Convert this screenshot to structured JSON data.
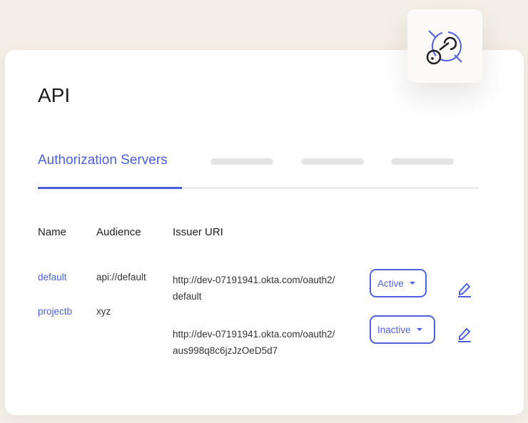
{
  "title": "API",
  "tabs": {
    "active": "Authorization Servers"
  },
  "columns": [
    "Name",
    "Audience",
    "Issuer URI"
  ],
  "rows": [
    {
      "name": "default",
      "audience": "api://default",
      "uri1": "http://dev-07191941.okta.com/oauth2/",
      "uri2": "default",
      "status": "Active"
    },
    {
      "name": "projectb",
      "audience": "xyz",
      "uri1": "http://dev-07191941.okta.com/oauth2/",
      "uri2": "aus998q8c6jzJzOeD5d7",
      "status": "Inactive"
    }
  ],
  "icons": {
    "tile": "api-key-icon",
    "edit": "pencil-icon",
    "caret": "caret-down-icon"
  },
  "colors": {
    "accent": "#4b5fd8"
  }
}
